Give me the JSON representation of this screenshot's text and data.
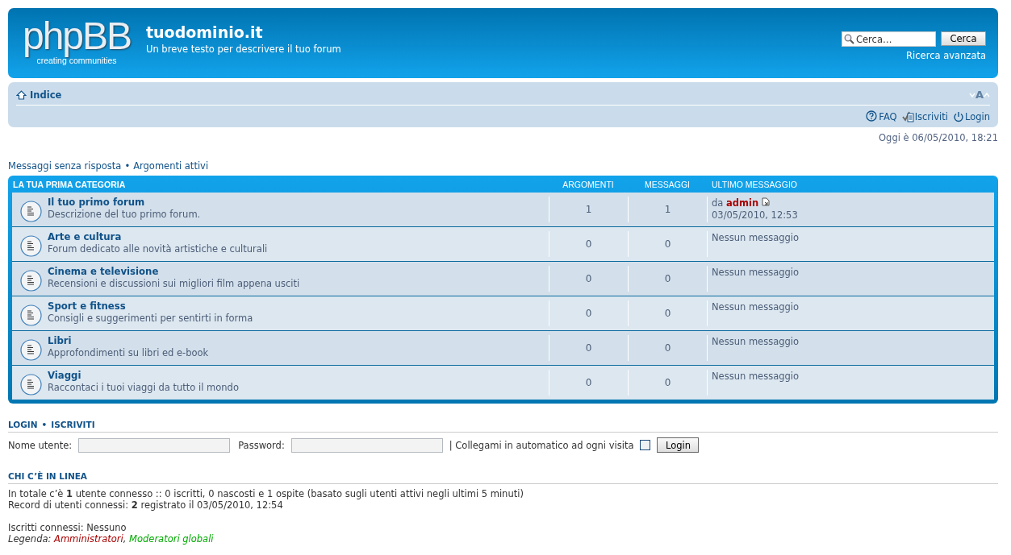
{
  "header": {
    "logo_text": "phpBB",
    "logo_tagline": "creating communities",
    "site_title": "tuodominio.it",
    "site_description": "Un breve testo per descrivere il tuo forum",
    "search": {
      "placeholder": "Cerca…",
      "button": "Cerca",
      "advanced": "Ricerca avanzata"
    }
  },
  "navbar": {
    "breadcrumb": "Indice",
    "font_size_label": "A",
    "links": [
      {
        "kind": "faq",
        "label": "FAQ"
      },
      {
        "kind": "register",
        "label": "Iscriviti"
      },
      {
        "kind": "login",
        "label": "Login"
      }
    ]
  },
  "current_time": "Oggi è 06/05/2010, 18:21",
  "quick_links": [
    "Messaggi senza risposta",
    "Argomenti attivi"
  ],
  "quick_links_separator": "•",
  "category": {
    "title": "LA TUA PRIMA CATEGORIA",
    "columns": [
      "ARGOMENTI",
      "MESSAGGI",
      "ULTIMO MESSAGGIO"
    ],
    "forums": [
      {
        "name": "Il tuo primo forum",
        "description": "Descrizione del tuo primo forum.",
        "topics": "1",
        "posts": "1",
        "last_post": {
          "kind": "post",
          "by": "da",
          "author": "admin",
          "date": "03/05/2010, 12:53"
        }
      },
      {
        "name": "Arte e cultura",
        "description": "Forum dedicato alle novità artistiche e culturali",
        "topics": "0",
        "posts": "0",
        "last_post": {
          "kind": "none",
          "text": "Nessun messaggio"
        }
      },
      {
        "name": "Cinema e televisione",
        "description": "Recensioni e discussioni sui migliori film appena usciti",
        "topics": "0",
        "posts": "0",
        "last_post": {
          "kind": "none",
          "text": "Nessun messaggio"
        }
      },
      {
        "name": "Sport e fitness",
        "description": "Consigli e suggerimenti per sentirti in forma",
        "topics": "0",
        "posts": "0",
        "last_post": {
          "kind": "none",
          "text": "Nessun messaggio"
        }
      },
      {
        "name": "Libri",
        "description": "Approfondimenti su libri ed e-book",
        "topics": "0",
        "posts": "0",
        "last_post": {
          "kind": "none",
          "text": "Nessun messaggio"
        }
      },
      {
        "name": "Viaggi",
        "description": "Raccontaci i tuoi viaggi da tutto il mondo",
        "topics": "0",
        "posts": "0",
        "last_post": {
          "kind": "none",
          "text": "Nessun messaggio"
        }
      }
    ]
  },
  "login": {
    "heading_links": [
      "LOGIN",
      "ISCRIVITI"
    ],
    "heading_separator": "•",
    "username_label": "Nome utente:",
    "password_label": "Password:",
    "autologin_label": "| Collegami in automatico ad ogni visita",
    "autologin_checked": false,
    "button": "Login"
  },
  "online": {
    "heading": "CHI C’È IN LINEA",
    "lines": [
      "In totale c’è **1** utente connesso :: 0 iscritti, 0 nascosti e 1 ospite (basato sugli utenti attivi negli ultimi 5 minuti)",
      "Record di utenti connessi: **2** registrato il 03/05/2010, 12:54"
    ],
    "registered": "Iscritti connessi: Nessuno",
    "legend_label": "Legenda:",
    "legend_separator": ",",
    "groups": [
      {
        "name": "Amministratori",
        "color": "#aa0000"
      },
      {
        "name": "Moderatori globali",
        "color": "#00aa00"
      }
    ]
  }
}
